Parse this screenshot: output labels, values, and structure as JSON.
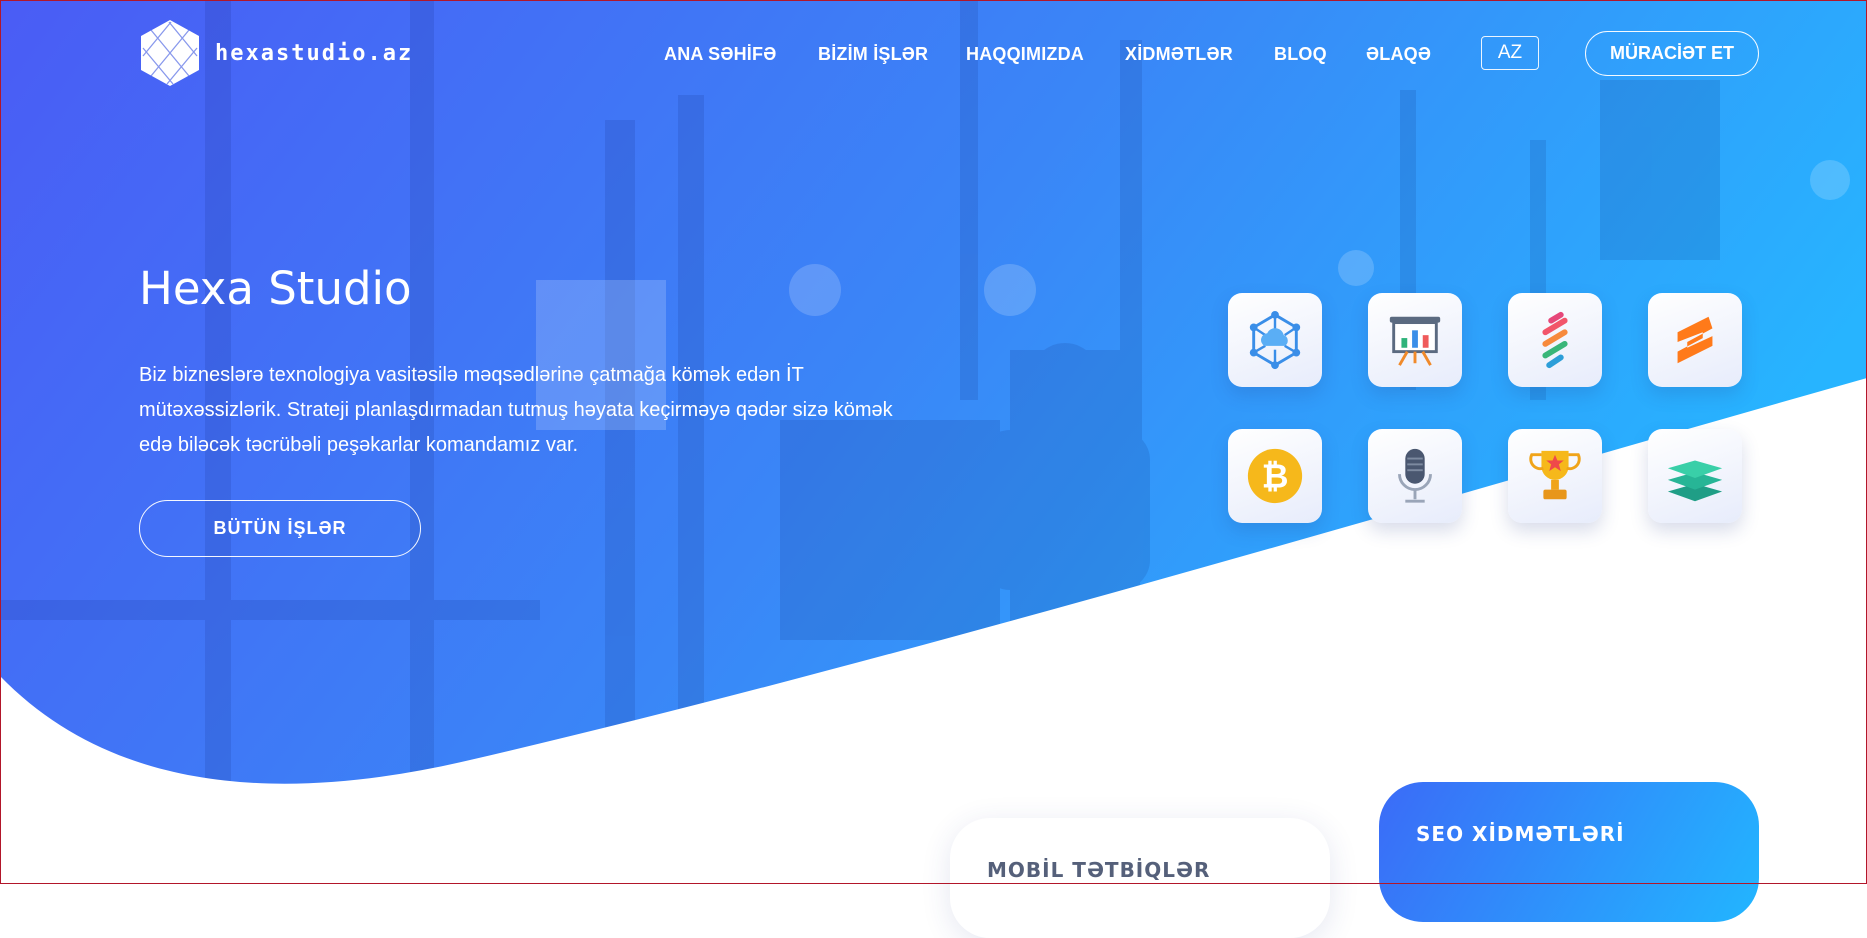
{
  "brand": {
    "logo_text": "hexastudio.az"
  },
  "nav": {
    "items": [
      {
        "label": "ANA SƏHİFƏ"
      },
      {
        "label": "BİZİM İŞLƏR"
      },
      {
        "label": "HAQQIMIZDA"
      },
      {
        "label": "XİDMƏTLƏR"
      },
      {
        "label": "BLOQ"
      },
      {
        "label": "ƏLAQƏ"
      }
    ],
    "language": "AZ",
    "apply_label": "MÜRACİƏT ET"
  },
  "hero": {
    "title": "Hexa Studio",
    "description": "Biz bizneslərə texnologiya vasitəsilə məqsədlərinə çatmağa kömək edən İT mütəxəssizlərik. Strateji planlaşdırmadan tutmuş həyata keçirməyə qədər sizə kömək edə biləcək təcrübəli peşəkarlar komandamız var.",
    "button_label": "BÜTÜN İŞLƏR"
  },
  "service_icons": [
    {
      "icon": "cloud-network-icon"
    },
    {
      "icon": "presentation-chart-icon"
    },
    {
      "icon": "stripes-app-icon"
    },
    {
      "icon": "sublime-s-icon"
    },
    {
      "icon": "bitcoin-icon"
    },
    {
      "icon": "microphone-icon"
    },
    {
      "icon": "trophy-icon"
    },
    {
      "icon": "layers-icon"
    }
  ],
  "cards": {
    "mobile_title": "MOBİL TƏTBİQLƏR",
    "seo_title": "SEO XİDMƏTLƏRİ"
  },
  "colors": {
    "hero_gradient_start": "#4a5cf5",
    "hero_gradient_end": "#27b4ff",
    "accent_orange": "#ff7a1a",
    "bitcoin_yellow": "#f6b81b",
    "frame_red": "#b2162a"
  }
}
